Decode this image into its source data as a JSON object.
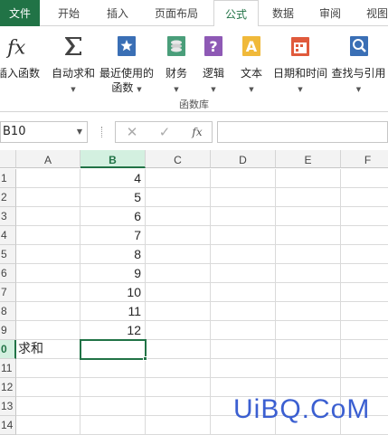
{
  "tabs": {
    "file": "文件",
    "home": "开始",
    "insert": "插入",
    "layout": "页面布局",
    "formulas": "公式",
    "data": "数据",
    "review": "审阅",
    "view": "视图"
  },
  "ribbon": {
    "insert_function": "插入函数",
    "autosum": "自动求和",
    "recent_l1": "最近使用的",
    "recent_l2": "函数",
    "financial": "财务",
    "logical": "逻辑",
    "text": "文本",
    "datetime": "日期和时间",
    "lookup": "查找与引用",
    "group_label": "函数库"
  },
  "formula_bar": {
    "name_box": "B10",
    "fx": "fx",
    "cancel": "✕",
    "enter": "✓",
    "value": ""
  },
  "columns": [
    "A",
    "B",
    "C",
    "D",
    "E",
    "F"
  ],
  "rows": [
    "1",
    "2",
    "3",
    "4",
    "5",
    "6",
    "7",
    "8",
    "9",
    "0",
    "11",
    "12",
    "13",
    "14"
  ],
  "cells": {
    "b_values": [
      "4",
      "5",
      "6",
      "7",
      "8",
      "9",
      "10",
      "11",
      "12"
    ],
    "a10": "求和"
  },
  "watermark": "UiBQ.CoM",
  "colors": {
    "accent": "#217346",
    "watermark": "#3b5fd1"
  }
}
